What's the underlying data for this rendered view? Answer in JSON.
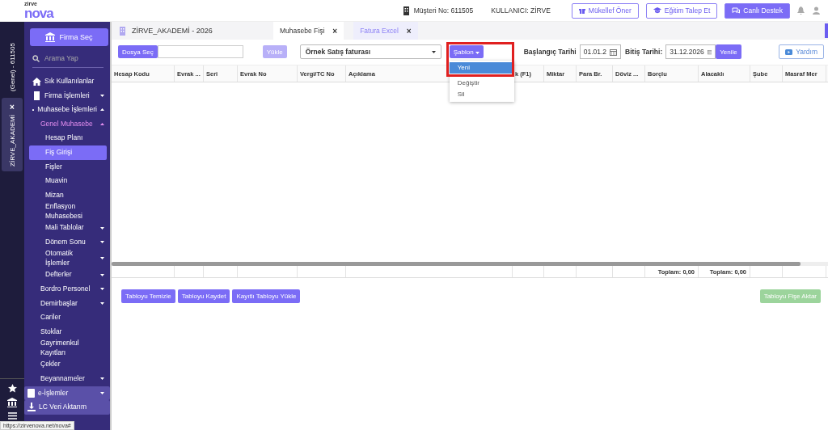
{
  "header": {
    "logo": {
      "small": "zirve",
      "big": "nova"
    },
    "customer": "Müşteri No: 611505",
    "user": "KULLANICI: ZİRVE",
    "buttons": [
      {
        "label": "Mükellef Öner",
        "kind": "outline"
      },
      {
        "label": "Eğitim Talep Et",
        "kind": "outline"
      },
      {
        "label": "Canlı Destek",
        "kind": "primary"
      }
    ]
  },
  "rail": {
    "company_label": "(Genel) - 611505",
    "tab": {
      "label": "ZİRVE_AKADEMİ",
      "close": "×"
    }
  },
  "sidebar": {
    "firm_button": "Firma Seç",
    "search": {
      "placeholder": "Arama Yap"
    },
    "items": [
      {
        "label": "Sık Kullanılanlar",
        "selected": false,
        "highlighted": false
      },
      {
        "label": "Firma İşlemleri",
        "selected": false,
        "highlighted": false,
        "expanded": false
      },
      {
        "label": "Muhasebe İşlemleri",
        "selected": false,
        "highlighted": false,
        "expanded": true,
        "children": [
          {
            "label": "Genel Muhasebe",
            "selected": false,
            "highlighted": false,
            "expanded": true,
            "children": [
              {
                "label": "Hesap Planı",
                "selected": false,
                "highlighted": false
              },
              {
                "label": "Fiş Girişi",
                "selected": true,
                "highlighted": false
              },
              {
                "label": "Fişler",
                "selected": false,
                "highlighted": false
              },
              {
                "label": "Muavin",
                "selected": false,
                "highlighted": false
              },
              {
                "label": "Mizan",
                "selected": false,
                "highlighted": false
              },
              {
                "label": "Enflasyon Muhasebesi",
                "selected": false,
                "highlighted": false
              },
              {
                "label": "Mali Tablolar",
                "selected": false,
                "highlighted": false,
                "expanded": false
              },
              {
                "label": "Dönem Sonu",
                "selected": false,
                "highlighted": false,
                "expanded": false
              },
              {
                "label": "Otomatik İşlemler",
                "selected": false,
                "highlighted": false,
                "expanded": false
              },
              {
                "label": "Defterler",
                "selected": false,
                "highlighted": false,
                "expanded": false
              }
            ]
          },
          {
            "label": "Bordro Personel",
            "selected": false,
            "highlighted": false,
            "expanded": false
          },
          {
            "label": "Demirbaşlar",
            "selected": false,
            "highlighted": false,
            "expanded": false
          },
          {
            "label": "Cariler",
            "selected": false,
            "highlighted": false
          },
          {
            "label": "Stoklar",
            "selected": false,
            "highlighted": false
          },
          {
            "label": "Gayrimenkul Kayıtları",
            "selected": false,
            "highlighted": false
          },
          {
            "label": "Çekler",
            "selected": false,
            "highlighted": false
          },
          {
            "label": "Beyannameler",
            "selected": false,
            "highlighted": false,
            "expanded": false
          }
        ]
      },
      {
        "label": "e-İşlemler",
        "selected": false,
        "highlighted": true,
        "expanded": false
      },
      {
        "label": "LC Veri Aktarım",
        "selected": false,
        "highlighted": true
      }
    ]
  },
  "company_title": "ZİRVE_AKADEMİ - 2026",
  "tabs": [
    {
      "label": "Muhasebe Fişi",
      "close": "×",
      "selected": false
    },
    {
      "label": "Fatura Excel",
      "close": "×",
      "selected": true
    }
  ],
  "toolbar": {
    "file_button": "Dosya Seç",
    "upload_button": {
      "label": "Yükle",
      "disabled": true
    },
    "template_select": "Örnek Satış faturası",
    "template_button": "Şablon",
    "template_menu": [
      {
        "label": "Yeni",
        "selected": true
      },
      {
        "label": "Değiştir",
        "selected": false
      },
      {
        "label": "Sil",
        "selected": false
      }
    ],
    "start_label": "Başlangıç Tarihi",
    "start_date": "01.01.2",
    "end_label": "Bitiş Tarihi:",
    "end_date": "31.12.2026",
    "refresh_button": "Yenile",
    "help_button": "Yardım"
  },
  "table": {
    "columns": [
      {
        "label": "Hesap Kodu"
      },
      {
        "label": "Evrak ..."
      },
      {
        "label": "Seri"
      },
      {
        "label": "Evrak No"
      },
      {
        "label": "Vergi/TC No"
      },
      {
        "label": "Açıklama"
      },
      {
        "label": "k (F1)"
      },
      {
        "label": "Miktar"
      },
      {
        "label": "Para Br."
      },
      {
        "label": "Döviz ..."
      },
      {
        "label": "Borçlu",
        "total": "Toplam: 0,00"
      },
      {
        "label": "Alacaklı",
        "total": "Toplam: 0,00"
      },
      {
        "label": "Şube"
      },
      {
        "label": "Masraf Mer"
      }
    ]
  },
  "actions": [
    {
      "label": "Tabloyu Temizle",
      "kind": "primary",
      "disabled": false
    },
    {
      "label": "Tabloyu Kaydet",
      "kind": "primary",
      "disabled": false
    },
    {
      "label": "Kayıtlı Tabloyu Yükle",
      "kind": "primary",
      "disabled": false
    },
    {
      "label": "Tabloyu Fişe Aktar",
      "kind": "success",
      "disabled": true
    }
  ],
  "status_url": "https://zirvenova.net/nova#"
}
